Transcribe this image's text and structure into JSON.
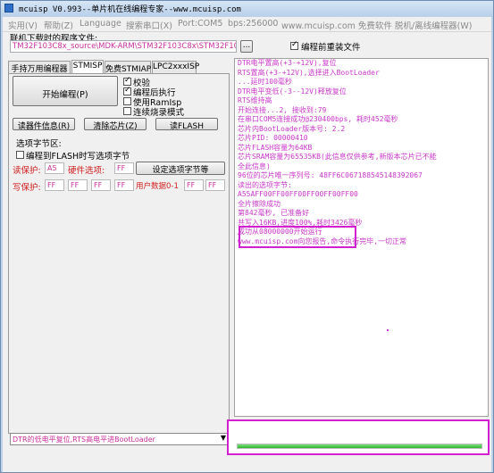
{
  "window": {
    "title": "mcuisp V0.993--单片机在线编程专家--www.mcuisp.com"
  },
  "menu": [
    "实用(V)",
    "帮助(Z)",
    "Language",
    "搜索串口(X)",
    "Port:COM5",
    "bps:256000",
    "www.mcuisp.com 免费软件 脱机/离线编程器(W)"
  ],
  "file": {
    "label": "联机下载时的程序文件:",
    "path": "TM32F103C8x_source\\MDK-ARM\\STM32F103C8x\\STM32F103C8x.hex",
    "browse": "...",
    "reload_label": "编程前重装文件",
    "reload_checked": true
  },
  "tabs": [
    "手持万用编程器",
    "STMISP",
    "免费STMIAP",
    "LPC2xxxISP"
  ],
  "active_tab": 1,
  "stmisp": {
    "start_button": "开始编程(P)",
    "options": [
      {
        "label": "校验",
        "checked": true
      },
      {
        "label": "编程后执行",
        "checked": true
      },
      {
        "label": "使用RamIsp",
        "checked": false
      },
      {
        "label": "连续烧录模式",
        "checked": false
      }
    ],
    "read_info_button": "读器件信息(R)",
    "erase_button": "清除芯片(Z)",
    "read_flash_button": "读FLASH",
    "option_bytes_title": "选项字节区:",
    "write_option_label": "编程到FLASH时写选项字节",
    "read_protect_label": "读保护:",
    "read_protect_value": "A5",
    "hw_option_label": "硬件选项:",
    "hw_option_value": "FF",
    "set_option_button": "设定选项字节等",
    "write_protect_label": "写保护:",
    "write_protect_values": [
      "FF",
      "FF",
      "FF",
      "FF"
    ],
    "user_data_label": "用户数据0-1",
    "user_data_values": [
      "FF",
      "FF"
    ]
  },
  "log": [
    "DTR电平置高(+3-+12V),复位",
    "RTS置高(+3-+12V),选择进入BootLoader",
    "...延时100毫秒",
    "DTR电平变低(-3--12V)释放复位",
    "RTS维持高",
    "开始连接...2, 接收到:79",
    "在串口COM5连接成功@230400bps, 耗时452毫秒",
    "芯片内BootLoader版本号: 2.2",
    "芯片PID: 00000410",
    "芯片FLASH容量为64KB",
    "芯片SRAM容量为65535KB(此信息仅供参考,新版本芯片已不能",
    "全此信息)",
    "96位的芯片唯一序列号: 48FF6C067188545148392067",
    "读出的选项字节:",
    "A55AFF00FF00FF00FF00FF00FF00",
    "全片擦除成功",
    "第842毫秒, 已准备好",
    "共写入16KB,进度100%,耗时3426毫秒",
    "成功从08000000开始运行",
    "www.mcuisp.com向您报告,命令执行完毕,一切正常"
  ],
  "status_select": "DTR的低电平复位,RTS高电平进BootLoader",
  "progress": 1.0,
  "colors": {
    "log_text": "#c838c8",
    "highlight": "#d020d0",
    "progress": "#2fb42f"
  }
}
